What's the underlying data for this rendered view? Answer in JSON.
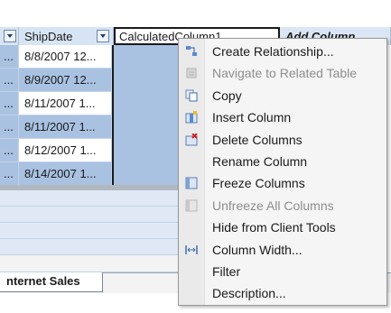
{
  "columns": {
    "prev_header": "",
    "shipdate_header": "ShipDate",
    "calc_header": "CalculatedColumn1",
    "add_header": "Add Column"
  },
  "rows": [
    {
      "prev": "...",
      "ship": "8/8/2007 12..."
    },
    {
      "prev": "...",
      "ship": "8/9/2007 12..."
    },
    {
      "prev": "...",
      "ship": "8/11/2007 1..."
    },
    {
      "prev": "...",
      "ship": "8/11/2007 1..."
    },
    {
      "prev": "...",
      "ship": "8/12/2007 1..."
    },
    {
      "prev": "...",
      "ship": "8/14/2007 1..."
    }
  ],
  "tab": {
    "label": "nternet Sales"
  },
  "menu": {
    "items": [
      {
        "label": "Create Relationship...",
        "icon": "relationship-icon",
        "enabled": true
      },
      {
        "label": "Navigate to Related Table",
        "icon": "navigate-icon",
        "enabled": false
      },
      {
        "label": "Copy",
        "icon": "copy-icon",
        "enabled": true
      },
      {
        "label": "Insert Column",
        "icon": "insert-column-icon",
        "enabled": true
      },
      {
        "label": "Delete Columns",
        "icon": "delete-columns-icon",
        "enabled": true
      },
      {
        "label": "Rename Column",
        "icon": "",
        "enabled": true
      },
      {
        "label": "Freeze Columns",
        "icon": "freeze-columns-icon",
        "enabled": true
      },
      {
        "label": "Unfreeze All Columns",
        "icon": "unfreeze-icon",
        "enabled": false
      },
      {
        "label": "Hide from Client Tools",
        "icon": "",
        "enabled": true
      },
      {
        "label": "Column Width...",
        "icon": "column-width-icon",
        "enabled": true
      },
      {
        "label": "Filter",
        "icon": "",
        "enabled": true
      },
      {
        "label": "Description...",
        "icon": "",
        "enabled": true
      }
    ]
  },
  "colors": {
    "header_bg": "#d7e4f3",
    "selected_cell": "#a9c2e2",
    "menu_bg": "#f5f5f5",
    "disabled_text": "#8d8d8d"
  }
}
